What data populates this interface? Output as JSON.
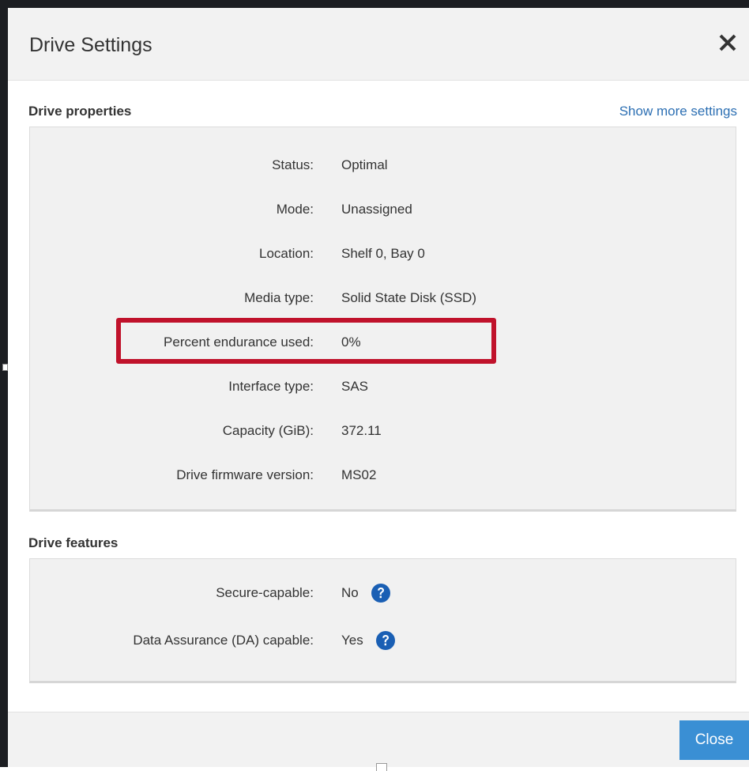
{
  "dialog": {
    "title": "Drive Settings",
    "close_icon": "close-icon"
  },
  "drive_properties": {
    "title": "Drive properties",
    "show_more": "Show more settings",
    "rows": [
      {
        "label": "Status:",
        "value": "Optimal"
      },
      {
        "label": "Mode:",
        "value": "Unassigned"
      },
      {
        "label": "Location:",
        "value": "Shelf 0, Bay 0"
      },
      {
        "label": "Media type:",
        "value": "Solid State Disk (SSD)"
      },
      {
        "label": "Percent endurance used:",
        "value": "0%"
      },
      {
        "label": "Interface type:",
        "value": "SAS"
      },
      {
        "label": "Capacity (GiB):",
        "value": "372.11"
      },
      {
        "label": "Drive firmware version:",
        "value": "MS02"
      }
    ]
  },
  "drive_features": {
    "title": "Drive features",
    "rows": [
      {
        "label": "Secure-capable:",
        "value": "No",
        "icon": "help-icon"
      },
      {
        "label": "Data Assurance (DA) capable:",
        "value": "Yes",
        "icon": "help-icon"
      }
    ]
  },
  "footer": {
    "close_label": "Close"
  },
  "colors": {
    "accent": "#3a8fd4",
    "link": "#2c6fb3",
    "highlight": "#c0122b",
    "help_icon": "#1a5fb4"
  }
}
